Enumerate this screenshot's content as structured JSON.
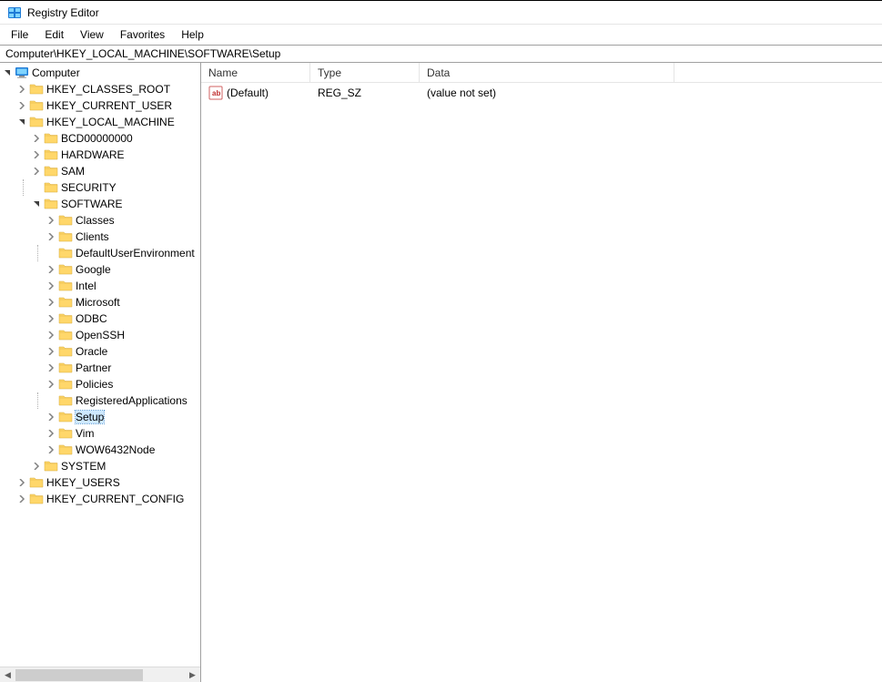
{
  "title": "Registry Editor",
  "menu": {
    "file": "File",
    "edit": "Edit",
    "view": "View",
    "favorites": "Favorites",
    "help": "Help"
  },
  "address": "Computer\\HKEY_LOCAL_MACHINE\\SOFTWARE\\Setup",
  "tree": {
    "root": "Computer",
    "hives": {
      "hkcr": "HKEY_CLASSES_ROOT",
      "hkcu": "HKEY_CURRENT_USER",
      "hklm": "HKEY_LOCAL_MACHINE",
      "hku": "HKEY_USERS",
      "hkcc": "HKEY_CURRENT_CONFIG"
    },
    "hklm_children": {
      "bcd": "BCD00000000",
      "hardware": "HARDWARE",
      "sam": "SAM",
      "security": "SECURITY",
      "software": "SOFTWARE",
      "system": "SYSTEM"
    },
    "software_children": {
      "classes": "Classes",
      "clients": "Clients",
      "defaultuserenv": "DefaultUserEnvironment",
      "google": "Google",
      "intel": "Intel",
      "microsoft": "Microsoft",
      "odbc": "ODBC",
      "openssh": "OpenSSH",
      "oracle": "Oracle",
      "partner": "Partner",
      "policies": "Policies",
      "registeredapps": "RegisteredApplications",
      "setup": "Setup",
      "vim": "Vim",
      "wow6432": "WOW6432Node"
    }
  },
  "list": {
    "headers": {
      "name": "Name",
      "type": "Type",
      "data": "Data"
    },
    "rows": [
      {
        "name": "(Default)",
        "type": "REG_SZ",
        "data": "(value not set)"
      }
    ]
  }
}
